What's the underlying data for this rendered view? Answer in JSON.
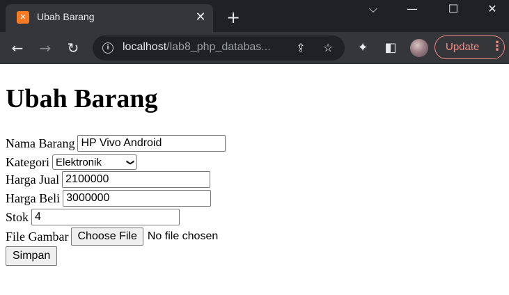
{
  "browser": {
    "tab_title": "Ubah Barang",
    "tab_favicon": "xampp-icon",
    "url_host": "localhost",
    "url_path": "/lab8_php_databas...",
    "update_label": "Update",
    "update_color": "#f28b82",
    "titlebar_color": "#202124",
    "toolbar_color": "#35363a"
  },
  "page": {
    "title": "Ubah Barang",
    "fields": {
      "nama_label": "Nama Barang",
      "nama_value": "HP Vivo Android",
      "kategori_label": "Kategori",
      "kategori_value": "Elektronik",
      "harga_jual_label": "Harga Jual",
      "harga_jual_value": "2100000",
      "harga_beli_label": "Harga Beli",
      "harga_beli_value": "3000000",
      "stok_label": "Stok",
      "stok_value": "4",
      "gambar_label": "File Gambar",
      "file_button": "Choose File",
      "file_status": "No file chosen"
    },
    "submit_label": "Simpan"
  }
}
